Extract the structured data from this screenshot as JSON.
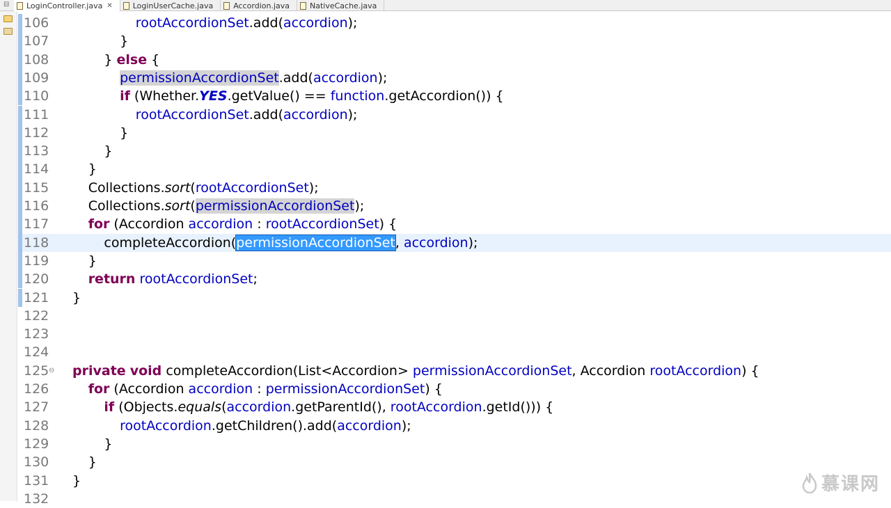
{
  "tabs": [
    {
      "label": "LoginController.java",
      "active": true,
      "closable": true
    },
    {
      "label": "LoginUserCache.java",
      "active": false,
      "closable": false
    },
    {
      "label": "Accordion.java",
      "active": false,
      "closable": false
    },
    {
      "label": "NativeCache.java",
      "active": false,
      "closable": false
    }
  ],
  "editor": {
    "current_line": "118",
    "lines": [
      {
        "num": "106",
        "changed": true,
        "indent": 4,
        "tokens": [
          {
            "t": "rootAccordionSet",
            "c": "fld"
          },
          {
            "t": ".add("
          },
          {
            "t": "accordion",
            "c": "fld"
          },
          {
            "t": ");"
          }
        ]
      },
      {
        "num": "107",
        "changed": true,
        "indent": 3,
        "tokens": [
          {
            "t": "}"
          }
        ]
      },
      {
        "num": "108",
        "changed": true,
        "indent": 2,
        "tokens": [
          {
            "t": "} "
          },
          {
            "t": "else",
            "c": "kw"
          },
          {
            "t": " {"
          }
        ]
      },
      {
        "num": "109",
        "changed": true,
        "indent": 3,
        "tokens": [
          {
            "t": "permissionAccordionSet",
            "c": "fld occ"
          },
          {
            "t": ".add("
          },
          {
            "t": "accordion",
            "c": "fld"
          },
          {
            "t": ");"
          }
        ]
      },
      {
        "num": "110",
        "changed": true,
        "indent": 3,
        "tokens": [
          {
            "t": "if",
            "c": "kw"
          },
          {
            "t": " (Whether."
          },
          {
            "t": "YES",
            "c": "cst"
          },
          {
            "t": ".getValue() == "
          },
          {
            "t": "function",
            "c": "fld"
          },
          {
            "t": ".getAccordion()) {"
          }
        ]
      },
      {
        "num": "111",
        "changed": true,
        "indent": 4,
        "tokens": [
          {
            "t": "rootAccordionSet",
            "c": "fld"
          },
          {
            "t": ".add("
          },
          {
            "t": "accordion",
            "c": "fld"
          },
          {
            "t": ");"
          }
        ]
      },
      {
        "num": "112",
        "changed": true,
        "indent": 3,
        "tokens": [
          {
            "t": "}"
          }
        ]
      },
      {
        "num": "113",
        "changed": true,
        "indent": 2,
        "tokens": [
          {
            "t": "}"
          }
        ]
      },
      {
        "num": "114",
        "changed": true,
        "indent": 1,
        "tokens": [
          {
            "t": "}"
          }
        ]
      },
      {
        "num": "115",
        "changed": true,
        "indent": 1,
        "tokens": [
          {
            "t": "Collections."
          },
          {
            "t": "sort",
            "c": "st"
          },
          {
            "t": "("
          },
          {
            "t": "rootAccordionSet",
            "c": "fld"
          },
          {
            "t": ");"
          }
        ]
      },
      {
        "num": "116",
        "changed": true,
        "indent": 1,
        "tokens": [
          {
            "t": "Collections."
          },
          {
            "t": "sort",
            "c": "st"
          },
          {
            "t": "("
          },
          {
            "t": "permissionAccordionSet",
            "c": "fld occ"
          },
          {
            "t": ");"
          }
        ]
      },
      {
        "num": "117",
        "changed": true,
        "indent": 1,
        "tokens": [
          {
            "t": "for",
            "c": "kw"
          },
          {
            "t": " (Accordion "
          },
          {
            "t": "accordion",
            "c": "fld"
          },
          {
            "t": " : "
          },
          {
            "t": "rootAccordionSet",
            "c": "fld"
          },
          {
            "t": ") {"
          }
        ]
      },
      {
        "num": "118",
        "changed": true,
        "indent": 2,
        "tokens": [
          {
            "t": "completeAccordion("
          },
          {
            "t": "permissionAccordionSet",
            "c": "fld sel"
          },
          {
            "t": ", "
          },
          {
            "t": "accordion",
            "c": "fld"
          },
          {
            "t": ");"
          }
        ]
      },
      {
        "num": "119",
        "changed": true,
        "indent": 1,
        "tokens": [
          {
            "t": "}"
          }
        ]
      },
      {
        "num": "120",
        "changed": true,
        "indent": 1,
        "tokens": [
          {
            "t": "return",
            "c": "kw"
          },
          {
            "t": " "
          },
          {
            "t": "rootAccordionSet",
            "c": "fld"
          },
          {
            "t": ";"
          }
        ]
      },
      {
        "num": "121",
        "changed": true,
        "indent": 0,
        "tokens": [
          {
            "t": "}"
          }
        ]
      },
      {
        "num": "122",
        "changed": false,
        "indent": 0,
        "tokens": []
      },
      {
        "num": "123",
        "changed": false,
        "indent": 0,
        "tokens": []
      },
      {
        "num": "124",
        "changed": false,
        "indent": 0,
        "tokens": []
      },
      {
        "num": "125",
        "changed": false,
        "fold": true,
        "indent": 0,
        "tokens": [
          {
            "t": "private",
            "c": "kw"
          },
          {
            "t": " "
          },
          {
            "t": "void",
            "c": "kw"
          },
          {
            "t": " completeAccordion(List<Accordion> "
          },
          {
            "t": "permissionAccordionSet",
            "c": "fld"
          },
          {
            "t": ", Accordion "
          },
          {
            "t": "rootAccordion",
            "c": "fld"
          },
          {
            "t": ") {"
          }
        ]
      },
      {
        "num": "126",
        "changed": false,
        "indent": 1,
        "tokens": [
          {
            "t": "for",
            "c": "kw"
          },
          {
            "t": " (Accordion "
          },
          {
            "t": "accordion",
            "c": "fld"
          },
          {
            "t": " : "
          },
          {
            "t": "permissionAccordionSet",
            "c": "fld"
          },
          {
            "t": ") {"
          }
        ]
      },
      {
        "num": "127",
        "changed": false,
        "indent": 2,
        "tokens": [
          {
            "t": "if",
            "c": "kw"
          },
          {
            "t": " (Objects."
          },
          {
            "t": "equals",
            "c": "st"
          },
          {
            "t": "("
          },
          {
            "t": "accordion",
            "c": "fld"
          },
          {
            "t": ".getParentId(), "
          },
          {
            "t": "rootAccordion",
            "c": "fld"
          },
          {
            "t": ".getId())) {"
          }
        ]
      },
      {
        "num": "128",
        "changed": false,
        "indent": 3,
        "tokens": [
          {
            "t": "rootAccordion",
            "c": "fld"
          },
          {
            "t": ".getChildren().add("
          },
          {
            "t": "accordion",
            "c": "fld"
          },
          {
            "t": ");"
          }
        ]
      },
      {
        "num": "129",
        "changed": false,
        "indent": 2,
        "tokens": [
          {
            "t": "}"
          }
        ]
      },
      {
        "num": "130",
        "changed": false,
        "indent": 1,
        "tokens": [
          {
            "t": "}"
          }
        ]
      },
      {
        "num": "131",
        "changed": false,
        "indent": 0,
        "tokens": [
          {
            "t": "}"
          }
        ]
      },
      {
        "num": "132",
        "changed": false,
        "indent": 0,
        "tokens": []
      }
    ]
  },
  "icons": {
    "tab_file": "java-file-icon",
    "tab_close": "close-icon",
    "toolbar": [
      "package-explorer-icon",
      "hierarchy-icon"
    ]
  },
  "watermark": {
    "text": "慕课网",
    "color": "#c9c9c9"
  },
  "colors": {
    "keyword": "#7f0055",
    "field": "#0000c0",
    "selection": "#3399ff",
    "current_line": "#e8f2fe"
  }
}
